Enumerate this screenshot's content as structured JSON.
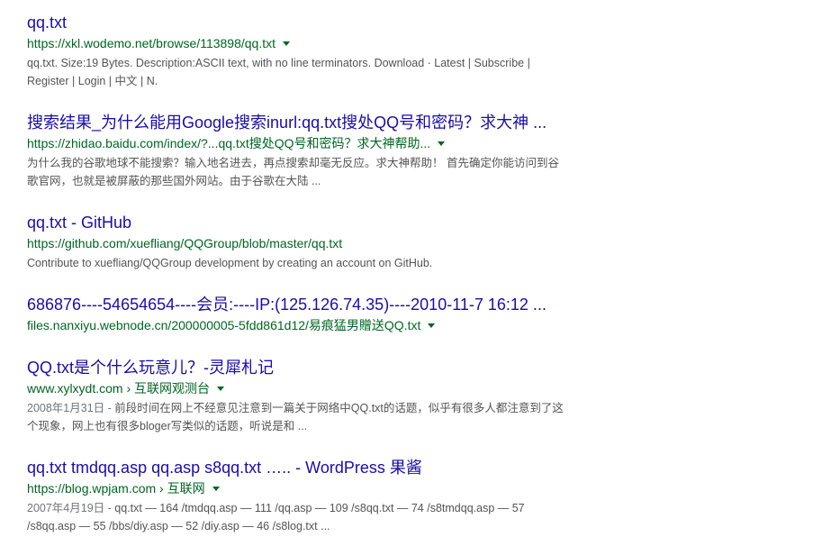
{
  "results": [
    {
      "title": "qq.txt",
      "url": "https://xkl.wodemo.net/browse/113898/qq.txt",
      "has_menu": true,
      "date": "",
      "snippet": "qq.txt. Size:19 Bytes. Description:ASCII text, with no line terminators. Download · Latest | Subscribe | Register | Login | 中文 | N."
    },
    {
      "title": "搜索结果_为什么能用Google搜索inurl:qq.txt搜处QQ号和密码？求大神 ...",
      "url": "https://zhidao.baidu.com/index/?...qq.txt搜处QQ号和密码？求大神帮助...",
      "has_menu": true,
      "date": "",
      "snippet": "为什么我的谷歌地球不能搜索？输入地名进去，再点搜索却毫无反应。求大神帮助！ 首先确定你能访问到谷歌官网，也就是被屏蔽的那些国外网站。由于谷歌在大陆 ..."
    },
    {
      "title": "qq.txt - GitHub",
      "url": "https://github.com/xuefliang/QQGroup/blob/master/qq.txt",
      "has_menu": false,
      "date": "",
      "snippet": "Contribute to xuefliang/QQGroup development by creating an account on GitHub."
    },
    {
      "title": "686876----54654654----会员:----IP:(125.126.74.35)----2010-11-7 16:12 ...",
      "url": "files.nanxiyu.webnode.cn/200000005-5fdd861d12/易痕猛男贈送QQ.txt",
      "has_menu": true,
      "date": "",
      "snippet": ""
    },
    {
      "title": "QQ.txt是个什么玩意儿？-灵犀札记",
      "url": "www.xylxydt.com › 互联网观测台",
      "has_menu": true,
      "date": "2008年1月31日 - ",
      "snippet": "前段时间在网上不经意见注意到一篇关于网络中QQ.txt的话题，似乎有很多人都注意到了这个现象，网上也有很多bloger写类似的话题，听说是和 ..."
    },
    {
      "title": "qq.txt tmdqq.asp qq.asp s8qq.txt ….. - WordPress 果酱",
      "url": "https://blog.wpjam.com › 互联网",
      "has_menu": true,
      "date": "2007年4月19日 - ",
      "snippet": "qq.txt — 164 /tmdqq.asp — 111 /qq.asp — 109 /s8qq.txt — 74 /s8tmdqq.asp — 57 /s8qq.asp — 55 /bbs/diy.asp — 52 /diy.asp — 46 /s8log.txt ..."
    }
  ],
  "colors": {
    "title": "#1a0dab",
    "url": "#006621",
    "snippet": "#545454"
  }
}
